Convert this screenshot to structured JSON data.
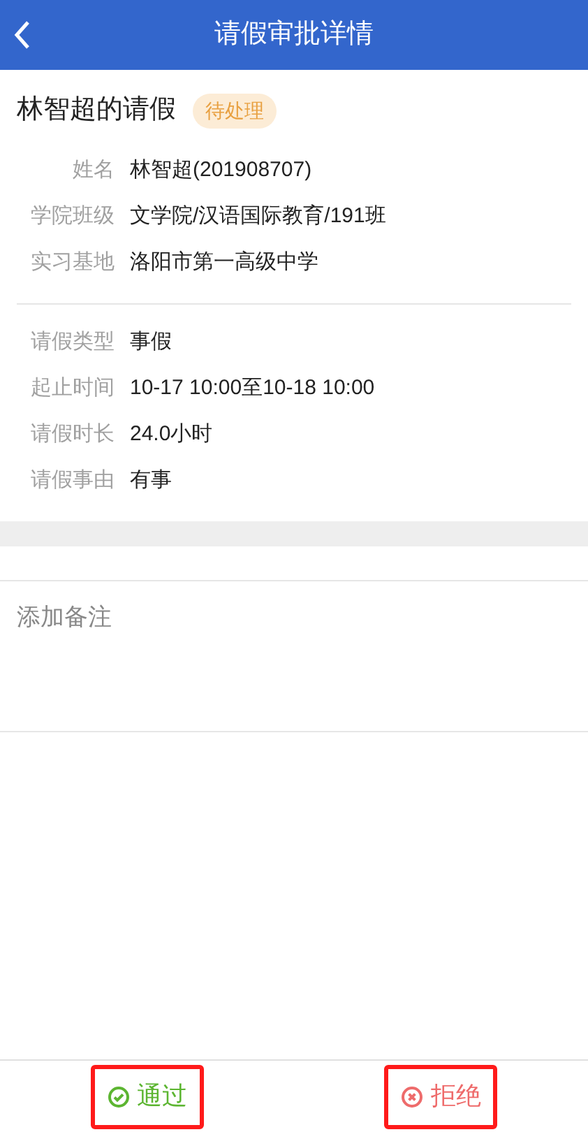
{
  "header": {
    "title": "请假审批详情"
  },
  "request": {
    "title": "林智超的请假",
    "status": "待处理"
  },
  "student_fields": [
    {
      "label": "姓名",
      "value": "林智超(201908707)"
    },
    {
      "label": "学院班级",
      "value": "文学院/汉语国际教育/191班"
    },
    {
      "label": "实习基地",
      "value": "洛阳市第一高级中学"
    }
  ],
  "leave_fields": [
    {
      "label": "请假类型",
      "value": "事假"
    },
    {
      "label": "起止时间",
      "value": "10-17 10:00至10-18 10:00"
    },
    {
      "label": "请假时长",
      "value": "24.0小时"
    },
    {
      "label": "请假事由",
      "value": "有事"
    }
  ],
  "remark": {
    "placeholder": "添加备注"
  },
  "actions": [
    {
      "kind": "approve",
      "label": "通过"
    },
    {
      "kind": "reject",
      "label": "拒绝"
    }
  ]
}
